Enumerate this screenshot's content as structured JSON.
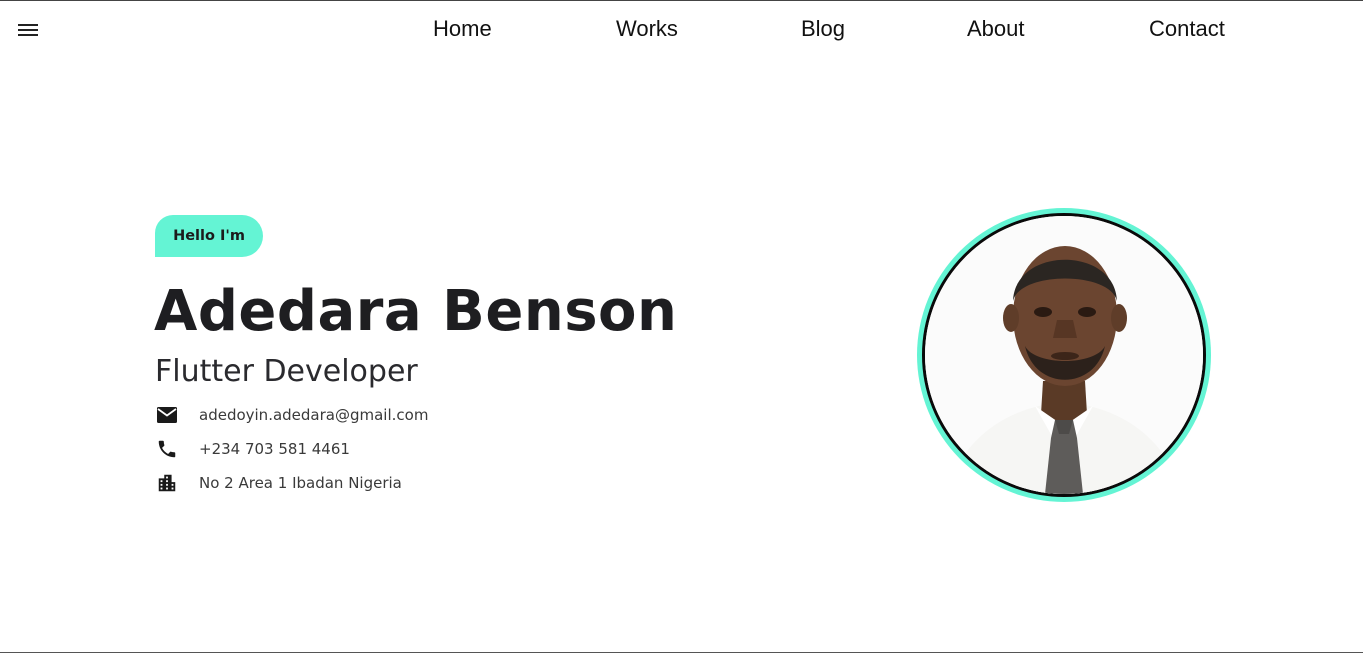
{
  "nav": {
    "items": [
      {
        "label": "Home"
      },
      {
        "label": "Works"
      },
      {
        "label": "Blog"
      },
      {
        "label": "About"
      },
      {
        "label": "Contact"
      }
    ]
  },
  "hero": {
    "badge": "Hello I'm",
    "name": "Adedara Benson",
    "role": "Flutter Developer",
    "email": "adedoyin.adedara@gmail.com",
    "phone": "+234 703 581 4461",
    "address": "No 2 Area 1 Ibadan Nigeria"
  },
  "icons": {
    "menu": "menu-icon",
    "email": "mail-icon",
    "phone": "phone-icon",
    "address": "building-icon"
  },
  "colors": {
    "accent": "#64f4d4",
    "text": "#1e1e21"
  }
}
